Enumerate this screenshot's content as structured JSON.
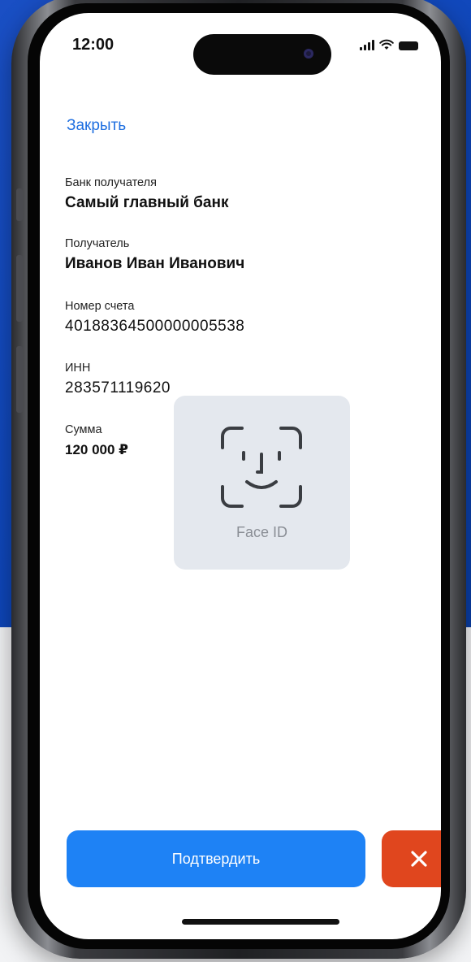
{
  "status_bar": {
    "time": "12:00"
  },
  "close_label": "Закрыть",
  "fields": [
    {
      "label": "Банк получателя",
      "value": "Самый главный банк"
    },
    {
      "label": "Получатель",
      "value": "Иванов Иван Иванович"
    },
    {
      "label": "Номер счета",
      "value": "40188364500000005538"
    },
    {
      "label": "ИНН",
      "value": "283571119620"
    },
    {
      "label": "Сумма",
      "value": "120 000 ₽"
    }
  ],
  "face_id": {
    "label": "Face ID"
  },
  "buttons": {
    "confirm": "Подтвердить",
    "cancel_icon": "close-icon"
  },
  "colors": {
    "background_blue": "#0d45b8",
    "link": "#1f6fe0",
    "confirm": "#1e82f5",
    "cancel": "#e0461e"
  }
}
